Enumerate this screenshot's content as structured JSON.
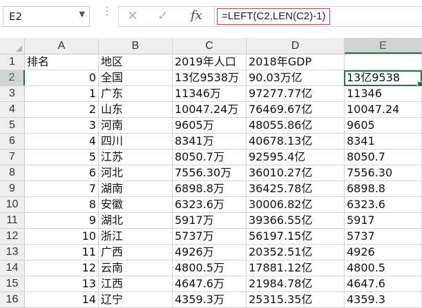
{
  "formula_bar": {
    "name_box": "E2",
    "cancel_icon": "✕",
    "enter_icon": "✓",
    "fx_label": "fx",
    "formula": "=LEFT(C2,LEN(C2)-1)"
  },
  "columns": [
    "A",
    "B",
    "C",
    "D",
    "E"
  ],
  "active_column": "E",
  "active_row": 2,
  "rows": [
    {
      "n": "1",
      "A": "排名",
      "B": "地区",
      "C": "2019年人口",
      "D": "2018年GDP",
      "E": ""
    },
    {
      "n": "2",
      "A": "0",
      "B": "全国",
      "C": "13亿9538万",
      "D": "90.03万亿",
      "E": "13亿9538"
    },
    {
      "n": "3",
      "A": "1",
      "B": "广东",
      "C": "11346万",
      "D": "97277.77亿",
      "E": "11346"
    },
    {
      "n": "4",
      "A": "2",
      "B": "山东",
      "C": "10047.24万",
      "D": "76469.67亿",
      "E": "10047.24"
    },
    {
      "n": "5",
      "A": "3",
      "B": "河南",
      "C": "9605万",
      "D": "48055.86亿",
      "E": "9605"
    },
    {
      "n": "6",
      "A": "4",
      "B": "四川",
      "C": "8341万",
      "D": "40678.13亿",
      "E": "8341"
    },
    {
      "n": "7",
      "A": "5",
      "B": "江苏",
      "C": "8050.7万",
      "D": "92595.4亿",
      "E": "8050.7"
    },
    {
      "n": "8",
      "A": "6",
      "B": "河北",
      "C": "7556.30万",
      "D": "36010.27亿",
      "E": "7556.30"
    },
    {
      "n": "9",
      "A": "7",
      "B": "湖南",
      "C": "6898.8万",
      "D": "36425.78亿",
      "E": "6898.8"
    },
    {
      "n": "10",
      "A": "8",
      "B": "安徽",
      "C": "6323.6万",
      "D": "30006.82亿",
      "E": "6323.6"
    },
    {
      "n": "11",
      "A": "9",
      "B": "湖北",
      "C": "5917万",
      "D": "39366.55亿",
      "E": "5917"
    },
    {
      "n": "12",
      "A": "10",
      "B": "浙江",
      "C": "5737万",
      "D": "56197.15亿",
      "E": "5737"
    },
    {
      "n": "13",
      "A": "11",
      "B": "广西",
      "C": "4926万",
      "D": "20352.51亿",
      "E": "4926"
    },
    {
      "n": "14",
      "A": "12",
      "B": "云南",
      "C": "4800.5万",
      "D": "17881.12亿",
      "E": "4800.5"
    },
    {
      "n": "15",
      "A": "13",
      "B": "江西",
      "C": "4647.6万",
      "D": "21984.78亿",
      "E": "4647.6"
    },
    {
      "n": "16",
      "A": "14",
      "B": "辽宁",
      "C": "4359.3万",
      "D": "25315.35亿",
      "E": "4359.3"
    }
  ],
  "accent_color": "#217346"
}
